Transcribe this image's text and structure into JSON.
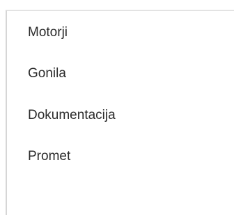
{
  "menu": {
    "items": [
      {
        "label": "Motorji"
      },
      {
        "label": "Gonila"
      },
      {
        "label": "Dokumentacija"
      },
      {
        "label": "Promet"
      }
    ]
  }
}
